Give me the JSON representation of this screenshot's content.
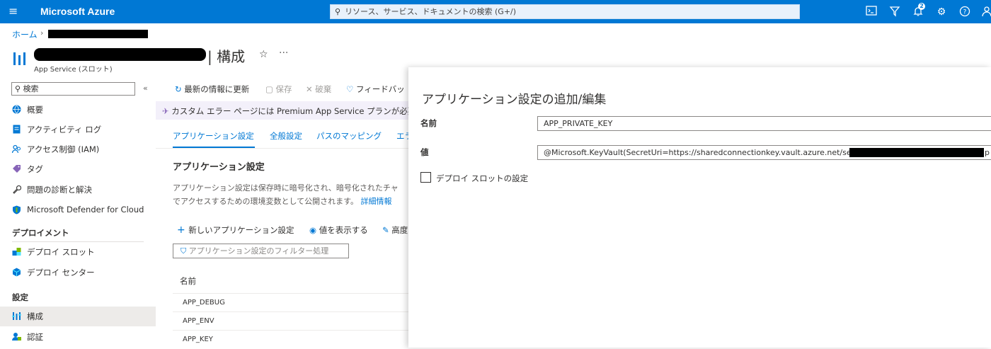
{
  "topbar": {
    "brand": "Microsoft Azure",
    "search_placeholder": "リソース、サービス、ドキュメントの検索 (G+/)",
    "notification_count": "2",
    "color": "#0078d4"
  },
  "breadcrumb": {
    "home": "ホーム"
  },
  "header": {
    "title": "| 構成",
    "subtitle": "App Service (スロット)"
  },
  "sidebar": {
    "search_placeholder": "検索",
    "items": [
      {
        "label": "概要",
        "icon": "globe-icon"
      },
      {
        "label": "アクティビティ ログ",
        "icon": "log-icon"
      },
      {
        "label": "アクセス制御 (IAM)",
        "icon": "people-icon"
      },
      {
        "label": "タグ",
        "icon": "tag-icon"
      },
      {
        "label": "問題の診断と解決",
        "icon": "wrench-icon"
      },
      {
        "label": "Microsoft Defender for Cloud",
        "icon": "shield-icon"
      }
    ],
    "sections": [
      {
        "title": "デプロイメント",
        "items": [
          {
            "label": "デプロイ スロット",
            "icon": "slots-icon"
          },
          {
            "label": "デプロイ センター",
            "icon": "cube-icon"
          }
        ]
      },
      {
        "title": "設定",
        "items": [
          {
            "label": "構成",
            "icon": "config-icon",
            "selected": true
          },
          {
            "label": "認証",
            "icon": "auth-icon"
          }
        ]
      }
    ]
  },
  "toolbar": {
    "refresh": "最新の情報に更新",
    "save": "保存",
    "discard": "破棄",
    "feedback": "フィードバッ"
  },
  "banner": "カスタム エラー ページには Premium App Service プランが必要",
  "tabs": [
    "アプリケーション設定",
    "全般設定",
    "パスのマッピング",
    "エラ"
  ],
  "section": {
    "title": "アプリケーション設定",
    "desc_line1": "アプリケーション設定は保存時に暗号化され、暗号化されたチャ",
    "desc_line2": "でアクセスするための環境変数として公開されます。",
    "desc_link": "詳細情報"
  },
  "actions": {
    "new": "新しいアプリケーション設定",
    "show_values": "値を表示する",
    "advanced": "高度"
  },
  "filter_placeholder": "アプリケーション設定のフィルター処理",
  "table": {
    "column": "名前",
    "rows": [
      "APP_DEBUG",
      "APP_ENV",
      "APP_KEY"
    ]
  },
  "panel": {
    "title": "アプリケーション設定の追加/編集",
    "name_label": "名前",
    "name_value": "APP_PRIVATE_KEY",
    "value_label": "値",
    "value_text": "@Microsoft.KeyVault(SecretUri=https://sharedconnectionkey.vault.azure.net/secrets/",
    "value_suffix": "p",
    "slot_setting_label": "デプロイ スロットの設定",
    "slot_setting_checked": false
  }
}
